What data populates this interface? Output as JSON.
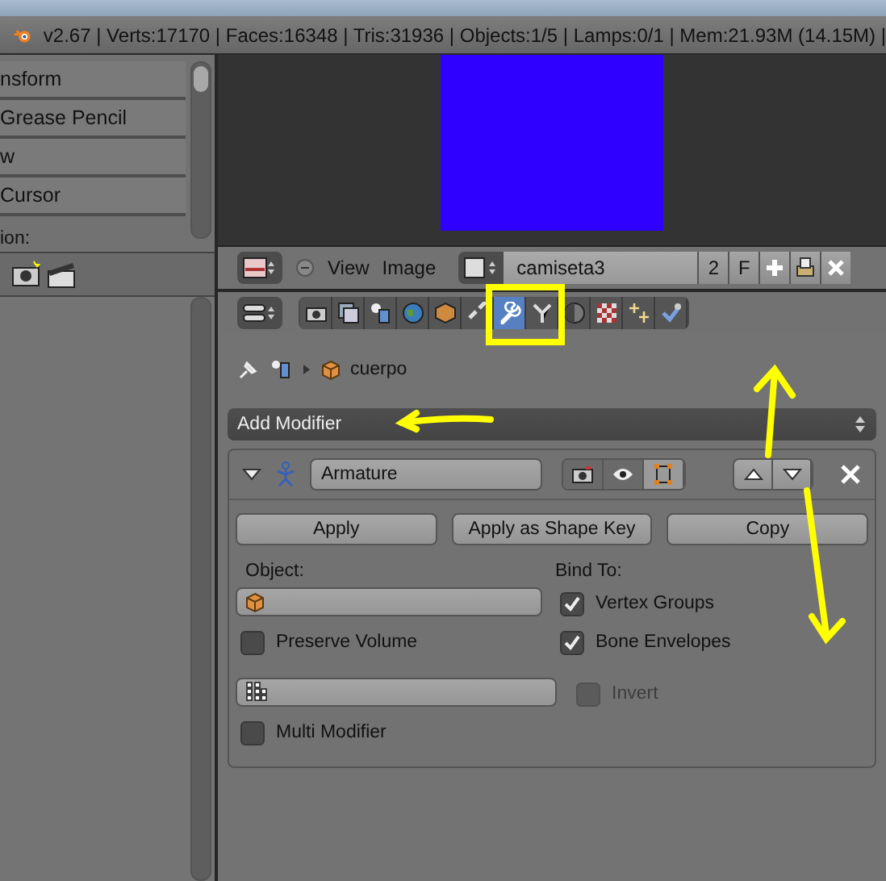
{
  "status_bar": {
    "text": "v2.67 | Verts:17170 | Faces:16348 | Tris:31936 | Objects:1/5 | Lamps:0/1 | Mem:21.93M (14.15M) |"
  },
  "tool_shelf": {
    "panels": [
      {
        "label": "nsform"
      },
      {
        "label": "Grease Pencil"
      },
      {
        "label": "w"
      },
      {
        "label": "Cursor"
      }
    ],
    "caption": "ion:"
  },
  "image_header": {
    "menus": [
      "View",
      "Image"
    ],
    "image_name": "camiseta3",
    "users": "2",
    "fake_user": "F"
  },
  "property_tabs": [
    {
      "kind": "render",
      "selected": false
    },
    {
      "kind": "layers",
      "selected": false
    },
    {
      "kind": "scene",
      "selected": false
    },
    {
      "kind": "world",
      "selected": false
    },
    {
      "kind": "object",
      "selected": false
    },
    {
      "kind": "constraints",
      "selected": false
    },
    {
      "kind": "modifiers",
      "selected": true
    },
    {
      "kind": "data",
      "selected": false
    },
    {
      "kind": "material",
      "selected": false
    },
    {
      "kind": "texture",
      "selected": false
    },
    {
      "kind": "particles",
      "selected": false
    },
    {
      "kind": "physics",
      "selected": false
    }
  ],
  "breadcrumb": {
    "object": "cuerpo"
  },
  "add_modifier": {
    "label": "Add Modifier"
  },
  "modifier": {
    "name": "Armature",
    "expanded": true,
    "show_render": true,
    "show_viewport": true,
    "show_editmode": true,
    "buttons": [
      "Apply",
      "Apply as Shape Key",
      "Copy"
    ],
    "object_label": "Object:",
    "bind_label": "Bind To:",
    "options": [
      {
        "label": "Preserve Volume",
        "checked": false,
        "disabled": false
      },
      {
        "label": "Vertex Groups",
        "checked": true,
        "disabled": false
      },
      {
        "label": "Bone Envelopes",
        "checked": true,
        "disabled": false
      },
      {
        "label": "Invert",
        "checked": false,
        "disabled": true
      },
      {
        "label": "Multi Modifier",
        "checked": false,
        "disabled": false
      }
    ]
  }
}
